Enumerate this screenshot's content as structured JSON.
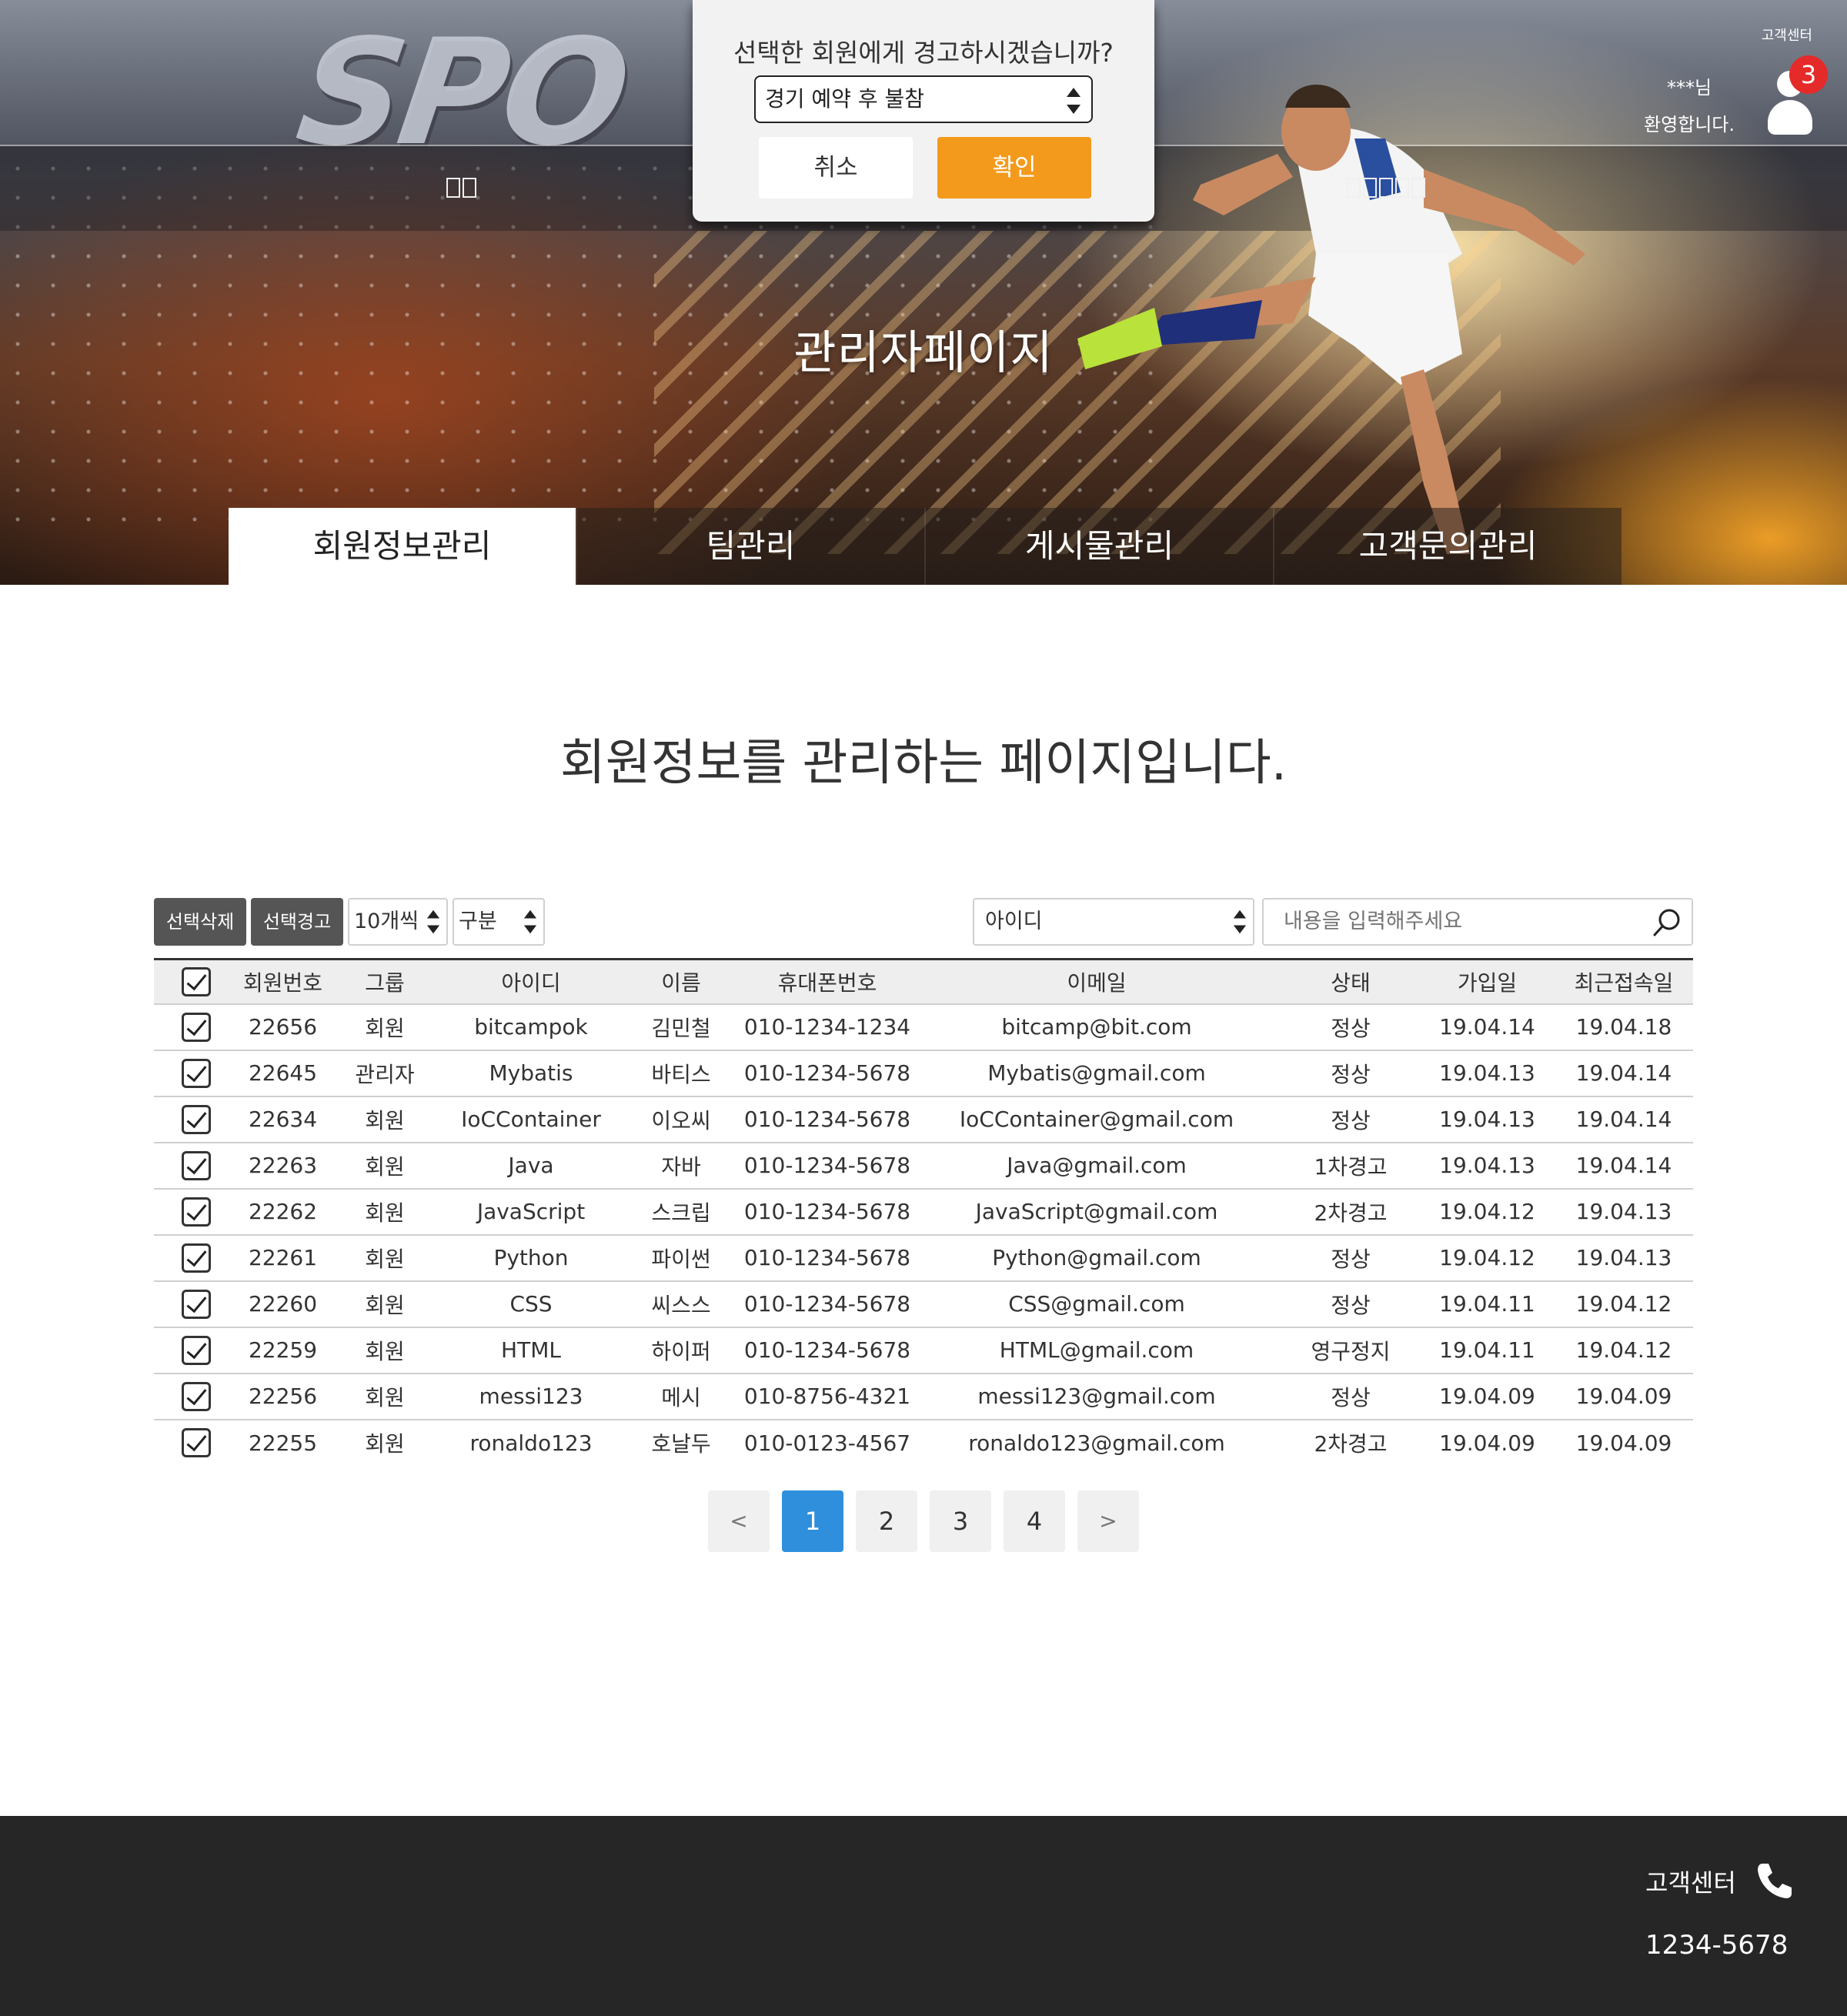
{
  "header": {
    "customer_center_link": "고객센터",
    "welcome_user": "***님",
    "welcome_message": "환영합니다.",
    "notification_count": "3",
    "title": "관리자페이지",
    "tabs": [
      {
        "label": "회원정보관리",
        "active": true
      },
      {
        "label": "팀관리",
        "active": false
      },
      {
        "label": "게시물관리",
        "active": false
      },
      {
        "label": "고객문의관리",
        "active": false
      }
    ]
  },
  "modal": {
    "title": "선택한 회원에게 경고하시겠습니까?",
    "selected_reason": "경기 예약 후 불참",
    "cancel_label": "취소",
    "confirm_label": "확인"
  },
  "main": {
    "heading": "회원정보를 관리하는 페이지입니다.",
    "toolbar": {
      "delete_selected": "선택삭제",
      "warn_selected": "선택경고",
      "per_page": "10개씩",
      "category": "구분",
      "search_field": "아이디",
      "search_placeholder": "내용을 입력해주세요"
    },
    "columns": [
      "회원번호",
      "그룹",
      "아이디",
      "이름",
      "휴대폰번호",
      "이메일",
      "상태",
      "가입일",
      "최근접속일"
    ],
    "rows": [
      {
        "no": "22656",
        "group": "회원",
        "id": "bitcampok",
        "name": "김민철",
        "phone": "010-1234-1234",
        "email": "bitcamp@bit.com",
        "status": "정상",
        "joined": "19.04.14",
        "last": "19.04.18"
      },
      {
        "no": "22645",
        "group": "관리자",
        "id": "Mybatis",
        "name": "바티스",
        "phone": "010-1234-5678",
        "email": "Mybatis@gmail.com",
        "status": "정상",
        "joined": "19.04.13",
        "last": "19.04.14"
      },
      {
        "no": "22634",
        "group": "회원",
        "id": "IoCContainer",
        "name": "이오씨",
        "phone": "010-1234-5678",
        "email": "IoCContainer@gmail.com",
        "status": "정상",
        "joined": "19.04.13",
        "last": "19.04.14"
      },
      {
        "no": "22263",
        "group": "회원",
        "id": "Java",
        "name": "자바",
        "phone": "010-1234-5678",
        "email": "Java@gmail.com",
        "status": "1차경고",
        "joined": "19.04.13",
        "last": "19.04.14"
      },
      {
        "no": "22262",
        "group": "회원",
        "id": "JavaScript",
        "name": "스크립",
        "phone": "010-1234-5678",
        "email": "JavaScript@gmail.com",
        "status": "2차경고",
        "joined": "19.04.12",
        "last": "19.04.13"
      },
      {
        "no": "22261",
        "group": "회원",
        "id": "Python",
        "name": "파이썬",
        "phone": "010-1234-5678",
        "email": "Python@gmail.com",
        "status": "정상",
        "joined": "19.04.12",
        "last": "19.04.13"
      },
      {
        "no": "22260",
        "group": "회원",
        "id": "CSS",
        "name": "씨스스",
        "phone": "010-1234-5678",
        "email": "CSS@gmail.com",
        "status": "정상",
        "joined": "19.04.11",
        "last": "19.04.12"
      },
      {
        "no": "22259",
        "group": "회원",
        "id": "HTML",
        "name": "하이퍼",
        "phone": "010-1234-5678",
        "email": "HTML@gmail.com",
        "status": "영구정지",
        "joined": "19.04.11",
        "last": "19.04.12"
      },
      {
        "no": "22256",
        "group": "회원",
        "id": "messi123",
        "name": "메시",
        "phone": "010-8756-4321",
        "email": "messi123@gmail.com",
        "status": "정상",
        "joined": "19.04.09",
        "last": "19.04.09"
      },
      {
        "no": "22255",
        "group": "회원",
        "id": "ronaldo123",
        "name": "호날두",
        "phone": "010-0123-4567",
        "email": "ronaldo123@gmail.com",
        "status": "2차경고",
        "joined": "19.04.09",
        "last": "19.04.09"
      }
    ],
    "pagination": {
      "prev": "<",
      "pages": [
        "1",
        "2",
        "3",
        "4"
      ],
      "current": "1",
      "next": ">"
    }
  },
  "footer": {
    "customer_center": "고객센터",
    "phone": "1234-5678"
  },
  "colors": {
    "accent": "#f39a1c",
    "active_page": "#2f8fdd",
    "footer_bg": "#262626",
    "badge": "#e52a2a"
  }
}
